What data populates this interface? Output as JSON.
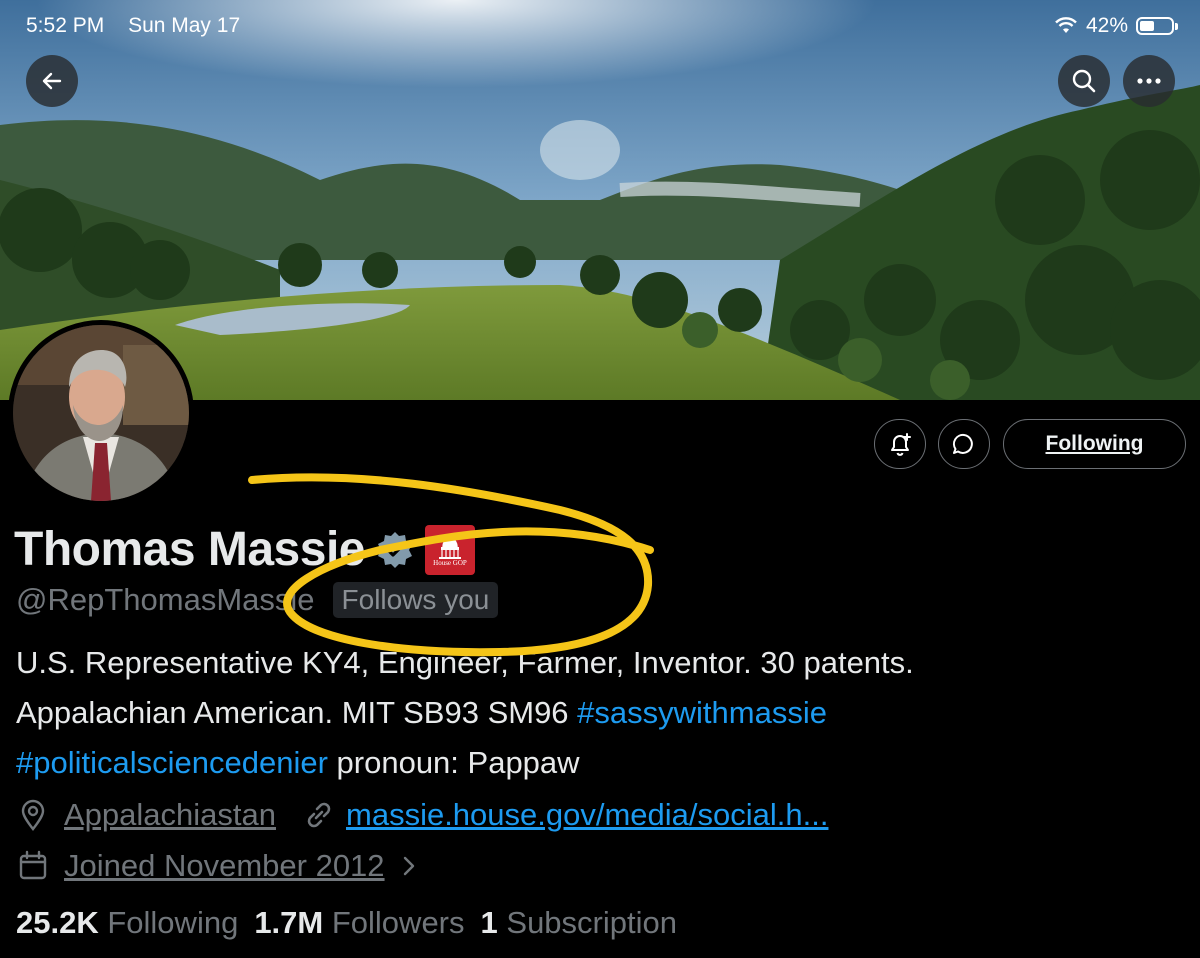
{
  "status_bar": {
    "time": "5:52 PM",
    "date": "Sun May 17",
    "battery": "42%",
    "battery_level": 0.42
  },
  "nav": {
    "back_icon": "arrow-left-icon",
    "search_icon": "search-icon",
    "more_icon": "more-horizontal-icon"
  },
  "profile": {
    "name": "Thomas Massie",
    "handle": "@RepThomasMassie",
    "follows_you": "Follows you",
    "affiliation_badge": "House GOP",
    "bio": {
      "line1": "U.S. Representative KY4, Engineer, Farmer, Inventor. 30 patents.",
      "line2": "Appalachian American. MIT SB93 SM96 ",
      "hashtag1": "#sassywithmassie",
      "hashtag2": "#politicalsciencedenier",
      "line3_rest": " pronoun: Pappaw"
    },
    "location": "Appalachiastan",
    "website": "massie.house.gov/media/social.h...",
    "joined": "Joined November 2012"
  },
  "actions": {
    "following_label": "Following"
  },
  "stats": {
    "following_count": "25.2K",
    "following_label": "Following",
    "followers_count": "1.7M",
    "followers_label": "Followers",
    "subscription_count": "1",
    "subscription_label": "Subscription"
  },
  "colors": {
    "background": "#000000",
    "link": "#1d9bf0",
    "muted": "#71767b",
    "annotation": "#f5c518",
    "gop_red": "#c9232d"
  }
}
